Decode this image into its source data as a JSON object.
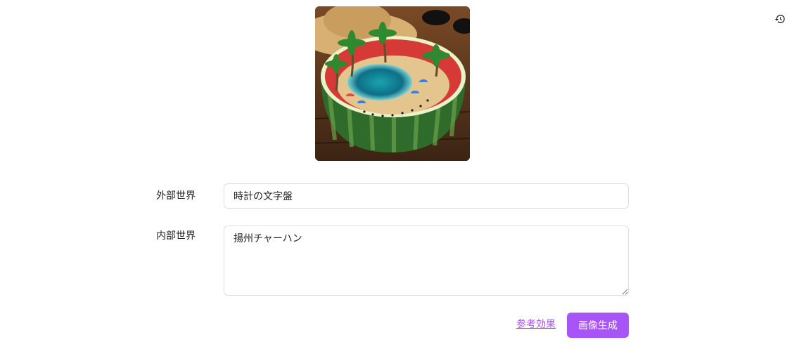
{
  "toolbar": {
    "history_icon": "history-clock-icon"
  },
  "preview": {
    "alt": "watermelon beach diorama"
  },
  "form": {
    "outer_world_label": "外部世界",
    "outer_world_value": "時計の文字盤",
    "inner_world_label": "内部世界",
    "inner_world_value": "揚州チャーハン"
  },
  "actions": {
    "reference_link": "参考効果",
    "generate_button": "画像生成"
  },
  "colors": {
    "accent": "#a855f7",
    "border": "#dcdfe6"
  }
}
